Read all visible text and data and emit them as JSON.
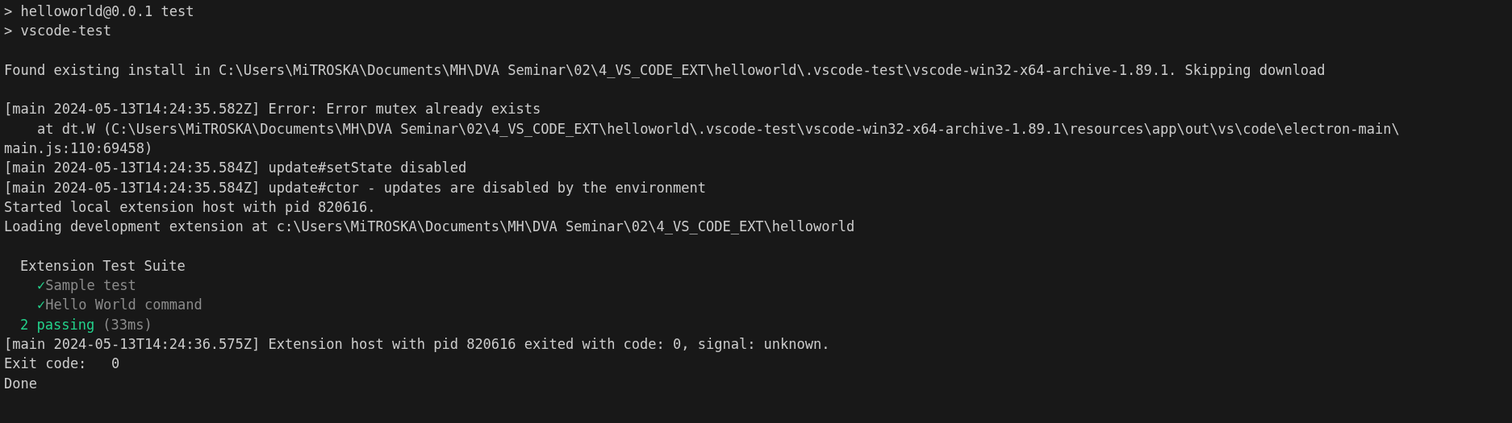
{
  "terminal": {
    "output": [
      {
        "kind": "line",
        "text": "> helloworld@0.0.1 test"
      },
      {
        "kind": "line",
        "text": "> vscode-test"
      },
      {
        "kind": "gap"
      },
      {
        "kind": "line",
        "text": "Found existing install in C:\\Users\\MiTROSKA\\Documents\\MH\\DVA Seminar\\02\\4_VS_CODE_EXT\\helloworld\\.vscode-test\\vscode-win32-x64-archive-1.89.1. Skipping download"
      },
      {
        "kind": "gap"
      },
      {
        "kind": "line",
        "text": "[main 2024-05-13T14:24:35.582Z] Error: Error mutex already exists"
      },
      {
        "kind": "stack",
        "text": "at dt.W (C:\\Users\\MiTROSKA\\Documents\\MH\\DVA Seminar\\02\\4_VS_CODE_EXT\\helloworld\\.vscode-test\\vscode-win32-x64-archive-1.89.1\\resources\\app\\out\\vs\\code\\electron-main\\"
      },
      {
        "kind": "line",
        "text": "main.js:110:69458)"
      },
      {
        "kind": "line",
        "text": "[main 2024-05-13T14:24:35.584Z] update#setState disabled"
      },
      {
        "kind": "line",
        "text": "[main 2024-05-13T14:24:35.584Z] update#ctor - updates are disabled by the environment"
      },
      {
        "kind": "line",
        "text": "Started local extension host with pid 820616."
      },
      {
        "kind": "line",
        "text": "Loading development extension at c:\\Users\\MiTROSKA\\Documents\\MH\\DVA Seminar\\02\\4_VS_CODE_EXT\\helloworld"
      },
      {
        "kind": "gap"
      },
      {
        "kind": "suite",
        "title": "Extension Test Suite",
        "tests": [
          {
            "mark": "✓",
            "name": "Sample test",
            "passed": true
          },
          {
            "mark": "✓",
            "name": "Hello World command",
            "passed": true
          }
        ],
        "passing": "2 passing",
        "duration": "(33ms)"
      },
      {
        "kind": "line",
        "text": "[main 2024-05-13T14:24:36.575Z] Extension host with pid 820616 exited with code: 0, signal: unknown."
      },
      {
        "kind": "line",
        "text": "Exit code:   0"
      },
      {
        "kind": "line",
        "text": "Done"
      }
    ]
  }
}
